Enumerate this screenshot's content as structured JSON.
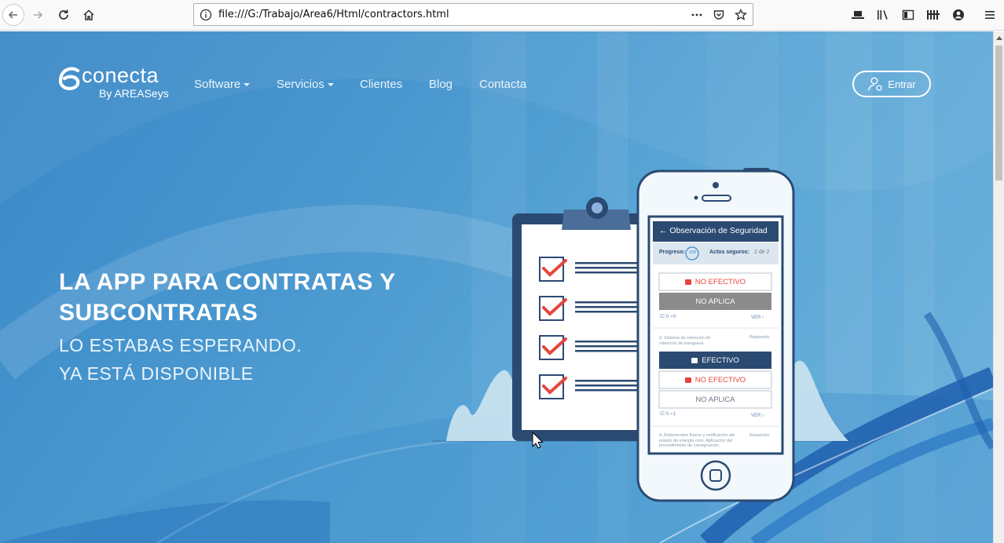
{
  "browser": {
    "url": "file:///G:/Trabajo/Area6/Html/contractors.html",
    "url_actions_icon": "ellipsis-icon"
  },
  "brand": {
    "name": "conecta",
    "tagline": "By AREASeys"
  },
  "nav": {
    "items": [
      {
        "label": "Software",
        "dropdown": true
      },
      {
        "label": "Servicios",
        "dropdown": true
      },
      {
        "label": "Clientes",
        "dropdown": false
      },
      {
        "label": "Blog",
        "dropdown": false
      },
      {
        "label": "Contacta",
        "dropdown": false
      }
    ],
    "login_label": "Entrar"
  },
  "hero": {
    "title_line1": "LA APP PARA CONTRATAS Y",
    "title_line2": "SUBCONTRATAS",
    "subtitle_line1": "LO ESTABAS ESPERANDO.",
    "subtitle_line2": "YA ESTÁ DISPONIBLE"
  },
  "phone": {
    "header_title": "Observación de Seguridad",
    "progress_label": "Progreso:",
    "progress_value": "100",
    "safe_acts_label": "Actos seguros:",
    "safe_acts_value": "2 de 2",
    "btn_not_effective": "NO EFECTIVO",
    "btn_not_applicable": "NO APLICA",
    "btn_effective": "EFECTIVO",
    "item1_checks": "0",
    "item1_attachments": "0",
    "ver_link": "VER ›",
    "item3_title": "3. Sistema de retención de retención de manguera.",
    "required_label": "Requerido",
    "item3_checks": "0",
    "item3_attachments": "1",
    "item4_title": "4. Aislamientos físicos y verificación del estado de energía cero. Aplicación del procedimiento de consignación."
  },
  "colors": {
    "accent": "#3a88c8",
    "navy": "#2b4a72",
    "check_red": "#e5463d",
    "not_applicable_gray": "#8b8b8b"
  }
}
